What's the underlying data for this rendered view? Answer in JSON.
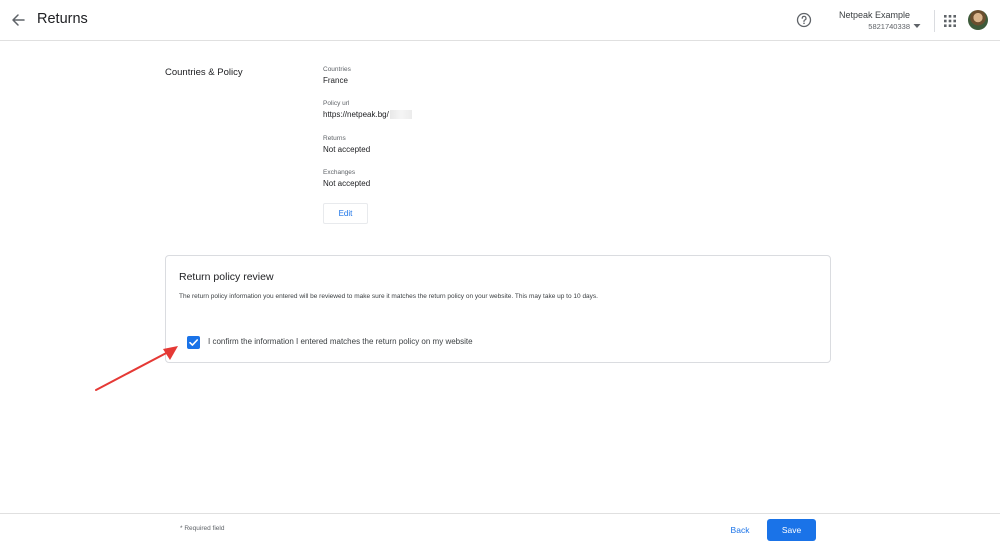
{
  "header": {
    "title": "Returns",
    "back_icon": "arrow-back-icon",
    "help_icon": "help-circle-icon",
    "account_name": "Netpeak Example",
    "account_id": "5821740338",
    "apps_icon": "apps-grid-icon"
  },
  "section": {
    "label": "Countries & Policy",
    "fields": {
      "countries": {
        "label": "Countries",
        "value": "France"
      },
      "policy_url": {
        "label": "Policy url",
        "value": "https://netpeak.bg/"
      },
      "returns": {
        "label": "Returns",
        "value": "Not accepted"
      },
      "exchanges": {
        "label": "Exchanges",
        "value": "Not accepted"
      }
    },
    "edit_label": "Edit"
  },
  "review": {
    "title": "Return policy review",
    "description": "The return policy information you entered will be reviewed to make sure it matches the return policy on your website. This may take up to 10 days.",
    "confirm_label": "I confirm the information I entered matches the return policy on my website",
    "confirm_checked": true
  },
  "footer": {
    "required_note": "* Required field",
    "back_label": "Back",
    "save_label": "Save"
  },
  "colors": {
    "accent": "#1a73e8",
    "annotation": "#e53935"
  }
}
